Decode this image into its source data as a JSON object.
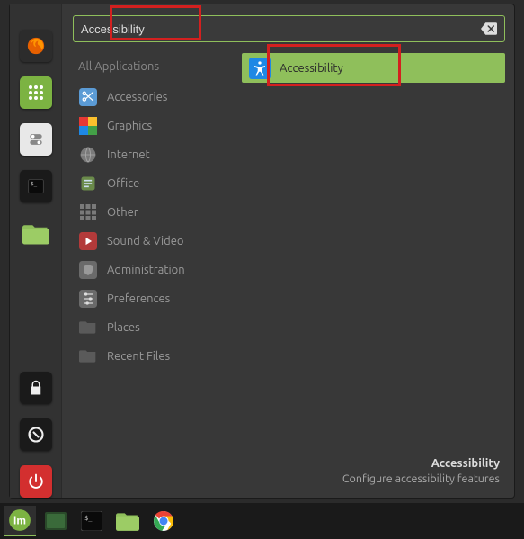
{
  "search": {
    "value": "Accessibility",
    "clear_icon": "backspace"
  },
  "favorites": [
    {
      "name": "firefox",
      "color": "#e66000"
    },
    {
      "name": "apps",
      "color": "#7cb342"
    },
    {
      "name": "settings",
      "color": "#e0e0e0"
    },
    {
      "name": "terminal",
      "color": "#1a1a1a"
    },
    {
      "name": "files",
      "color": "#8fbf5b"
    },
    {
      "name": "lock",
      "color": "#1a1a1a"
    },
    {
      "name": "logout",
      "color": "#1a1a1a"
    },
    {
      "name": "power",
      "color": "#d32f2f"
    }
  ],
  "categories": {
    "header": "All Applications",
    "items": [
      {
        "label": "Accessories",
        "icon": "scissors",
        "color": "#5b9bd5"
      },
      {
        "label": "Graphics",
        "icon": "palette",
        "color": "rainbow"
      },
      {
        "label": "Internet",
        "icon": "globe",
        "color": "#7a7a7a"
      },
      {
        "label": "Office",
        "icon": "doc",
        "color": "#6a8a4a"
      },
      {
        "label": "Other",
        "icon": "grid",
        "color": "#7a7a7a"
      },
      {
        "label": "Sound & Video",
        "icon": "play",
        "color": "#b33a3a"
      },
      {
        "label": "Administration",
        "icon": "shield",
        "color": "#6a6a6a"
      },
      {
        "label": "Preferences",
        "icon": "sliders",
        "color": "#6a6a6a"
      },
      {
        "label": "Places",
        "icon": "folder",
        "color": "#5a5a5a"
      },
      {
        "label": "Recent Files",
        "icon": "folder",
        "color": "#5a5a5a"
      }
    ]
  },
  "results": [
    {
      "label": "Accessibility",
      "icon": "accessibility",
      "selected": true
    }
  ],
  "footer": {
    "title": "Accessibility",
    "subtitle": "Configure accessibility features"
  },
  "taskbar": [
    {
      "name": "mint-menu",
      "active": true
    },
    {
      "name": "show-desktop"
    },
    {
      "name": "terminal"
    },
    {
      "name": "files"
    },
    {
      "name": "chrome"
    }
  ]
}
